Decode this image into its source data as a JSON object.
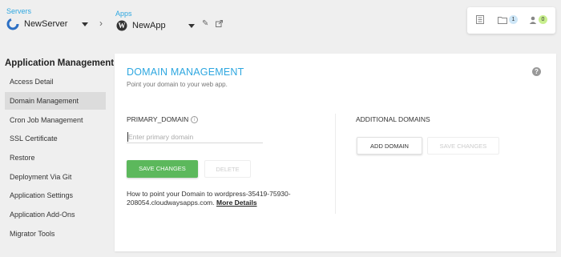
{
  "header": {
    "servers_label": "Servers",
    "server_name": "NewServer",
    "apps_label": "Apps",
    "app_name": "NewApp",
    "folder_badge": "1",
    "user_badge": "0"
  },
  "sidebar": {
    "title": "Application Management",
    "items": [
      {
        "label": "Access Detail"
      },
      {
        "label": "Domain Management"
      },
      {
        "label": "Cron Job Management"
      },
      {
        "label": "SSL Certificate"
      },
      {
        "label": "Restore"
      },
      {
        "label": "Deployment Via Git"
      },
      {
        "label": "Application Settings"
      },
      {
        "label": "Application Add-Ons"
      },
      {
        "label": "Migrator Tools"
      }
    ]
  },
  "panel": {
    "title": "DOMAIN MANAGEMENT",
    "subtitle": "Point your domain to your web app.",
    "primary_label": "PRIMARY_DOMAIN",
    "primary_placeholder": "Enter primary domain",
    "primary_value": "",
    "save_label": "SAVE CHANGES",
    "delete_label": "DELETE",
    "additional_label": "ADDITIONAL DOMAINS",
    "add_label": "ADD DOMAIN",
    "save2_label": "SAVE CHANGES",
    "howto_text": "How to point your Domain to wordpress-35419-75930-208054.cloudwaysapps.com.",
    "more_details": "More Details"
  },
  "colors": {
    "accent": "#2ea7e0",
    "green": "#5cb85c",
    "folder_badge_bg": "#cde6f7",
    "user_badge_bg": "#c8ef8e"
  },
  "icons": {
    "server": "cloudways-logo-icon",
    "app": "wordpress-icon"
  }
}
